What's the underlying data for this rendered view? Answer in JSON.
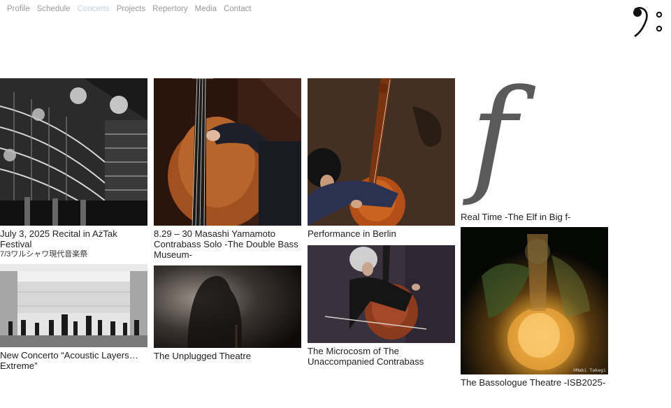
{
  "nav": {
    "items": [
      {
        "label": "Profile"
      },
      {
        "label": "Schedule"
      },
      {
        "label": "Concerts",
        "active": true
      },
      {
        "label": "Projects"
      },
      {
        "label": "Repertory"
      },
      {
        "label": "Media"
      },
      {
        "label": "Contact"
      }
    ]
  },
  "logo": {
    "icon": "bass-clef-icon"
  },
  "cards": {
    "recital": {
      "title": "July 3, 2025 Recital in AżTak Festival",
      "subtitle": "7/3ワルシャワ現代音楽祭"
    },
    "double_bass_museum": {
      "title": "8.29 – 30 Masashi Yamamoto Contrabass Solo -The Double Bass Museum-"
    },
    "berlin": {
      "title": "Performance in Berlin"
    },
    "elf": {
      "title": "Real Time -The Elf in Big f-",
      "glyph": "f"
    },
    "concerto": {
      "title": "New Concerto “Acoustic Layers… Extreme”"
    },
    "unplugged": {
      "title": "The Unplugged Theatre"
    },
    "microcosm": {
      "title": "The Microcosm of The Unaccompanied Contrabass"
    },
    "bassologue": {
      "title": "The Bassologue Theatre -ISB2025-",
      "credit": "©Maki Takegi"
    }
  }
}
